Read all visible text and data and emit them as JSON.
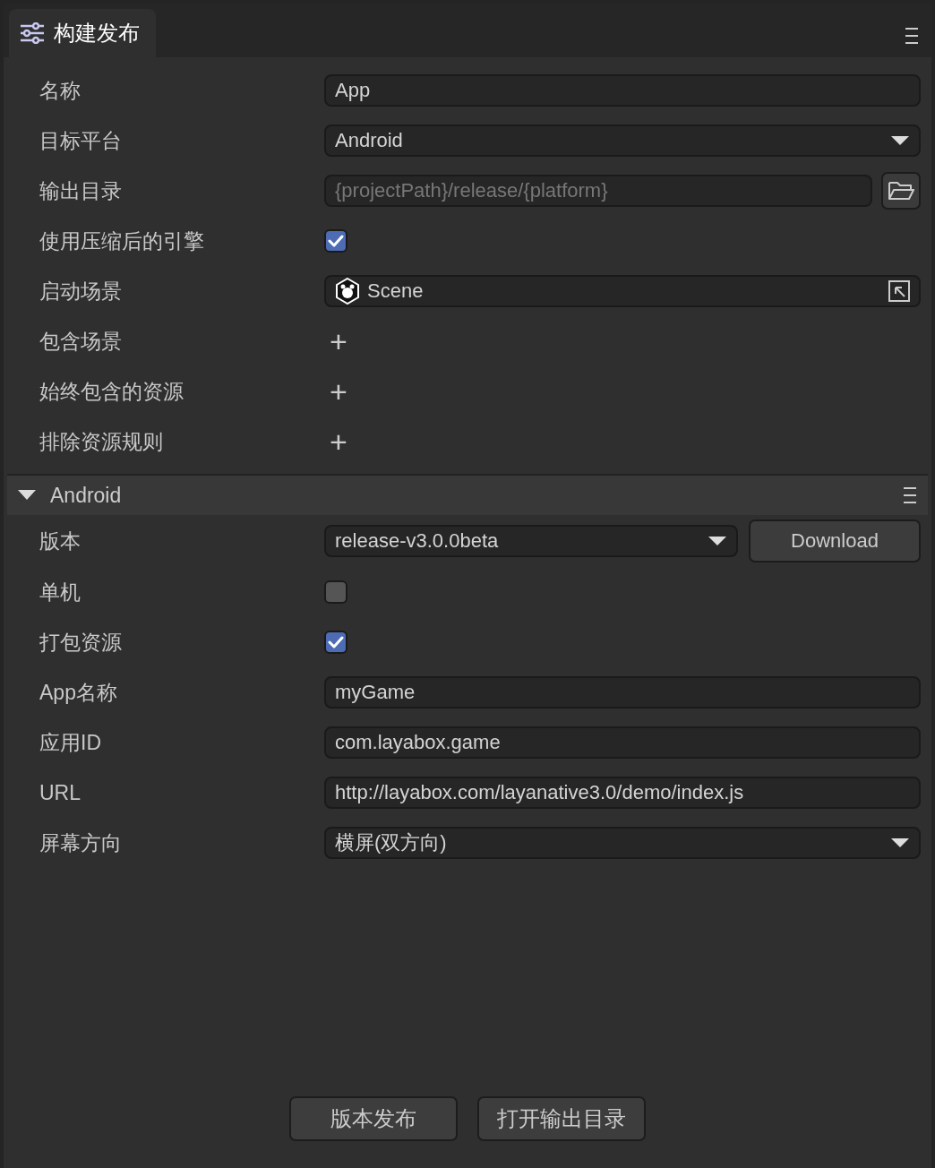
{
  "tab": {
    "label": "构建发布",
    "selected": true
  },
  "main_rows": [
    {
      "kind": "text",
      "label": "名称",
      "value": "App"
    },
    {
      "kind": "select",
      "label": "目标平台",
      "value": "Android"
    },
    {
      "kind": "path",
      "label": "输出目录",
      "placeholder": "{projectPath}/release/{platform}"
    },
    {
      "kind": "checkbox",
      "label": "使用压缩后的引擎",
      "checked": true
    },
    {
      "kind": "scene",
      "label": "启动场景",
      "value": "Scene"
    },
    {
      "kind": "add",
      "label": "包含场景",
      "value": "+"
    },
    {
      "kind": "add",
      "label": "始终包含的资源",
      "value": "+"
    },
    {
      "kind": "add",
      "label": "排除资源规则",
      "value": "+"
    }
  ],
  "section": {
    "title": "Android",
    "expanded": true
  },
  "section_rows": [
    {
      "kind": "version",
      "label": "版本",
      "value": "release-v3.0.0beta",
      "button": "Download"
    },
    {
      "kind": "checkbox",
      "label": "单机",
      "checked": false
    },
    {
      "kind": "checkbox",
      "label": "打包资源",
      "checked": true
    },
    {
      "kind": "text",
      "label": "App名称",
      "value": "myGame"
    },
    {
      "kind": "text",
      "label": "应用ID",
      "value": "com.layabox.game"
    },
    {
      "kind": "text",
      "label": "URL",
      "value": "http://layabox.com/layanative3.0/demo/index.js"
    },
    {
      "kind": "select",
      "label": "屏幕方向",
      "value": "横屏(双方向)"
    }
  ],
  "buttons": [
    "版本发布",
    "打开输出目录"
  ]
}
